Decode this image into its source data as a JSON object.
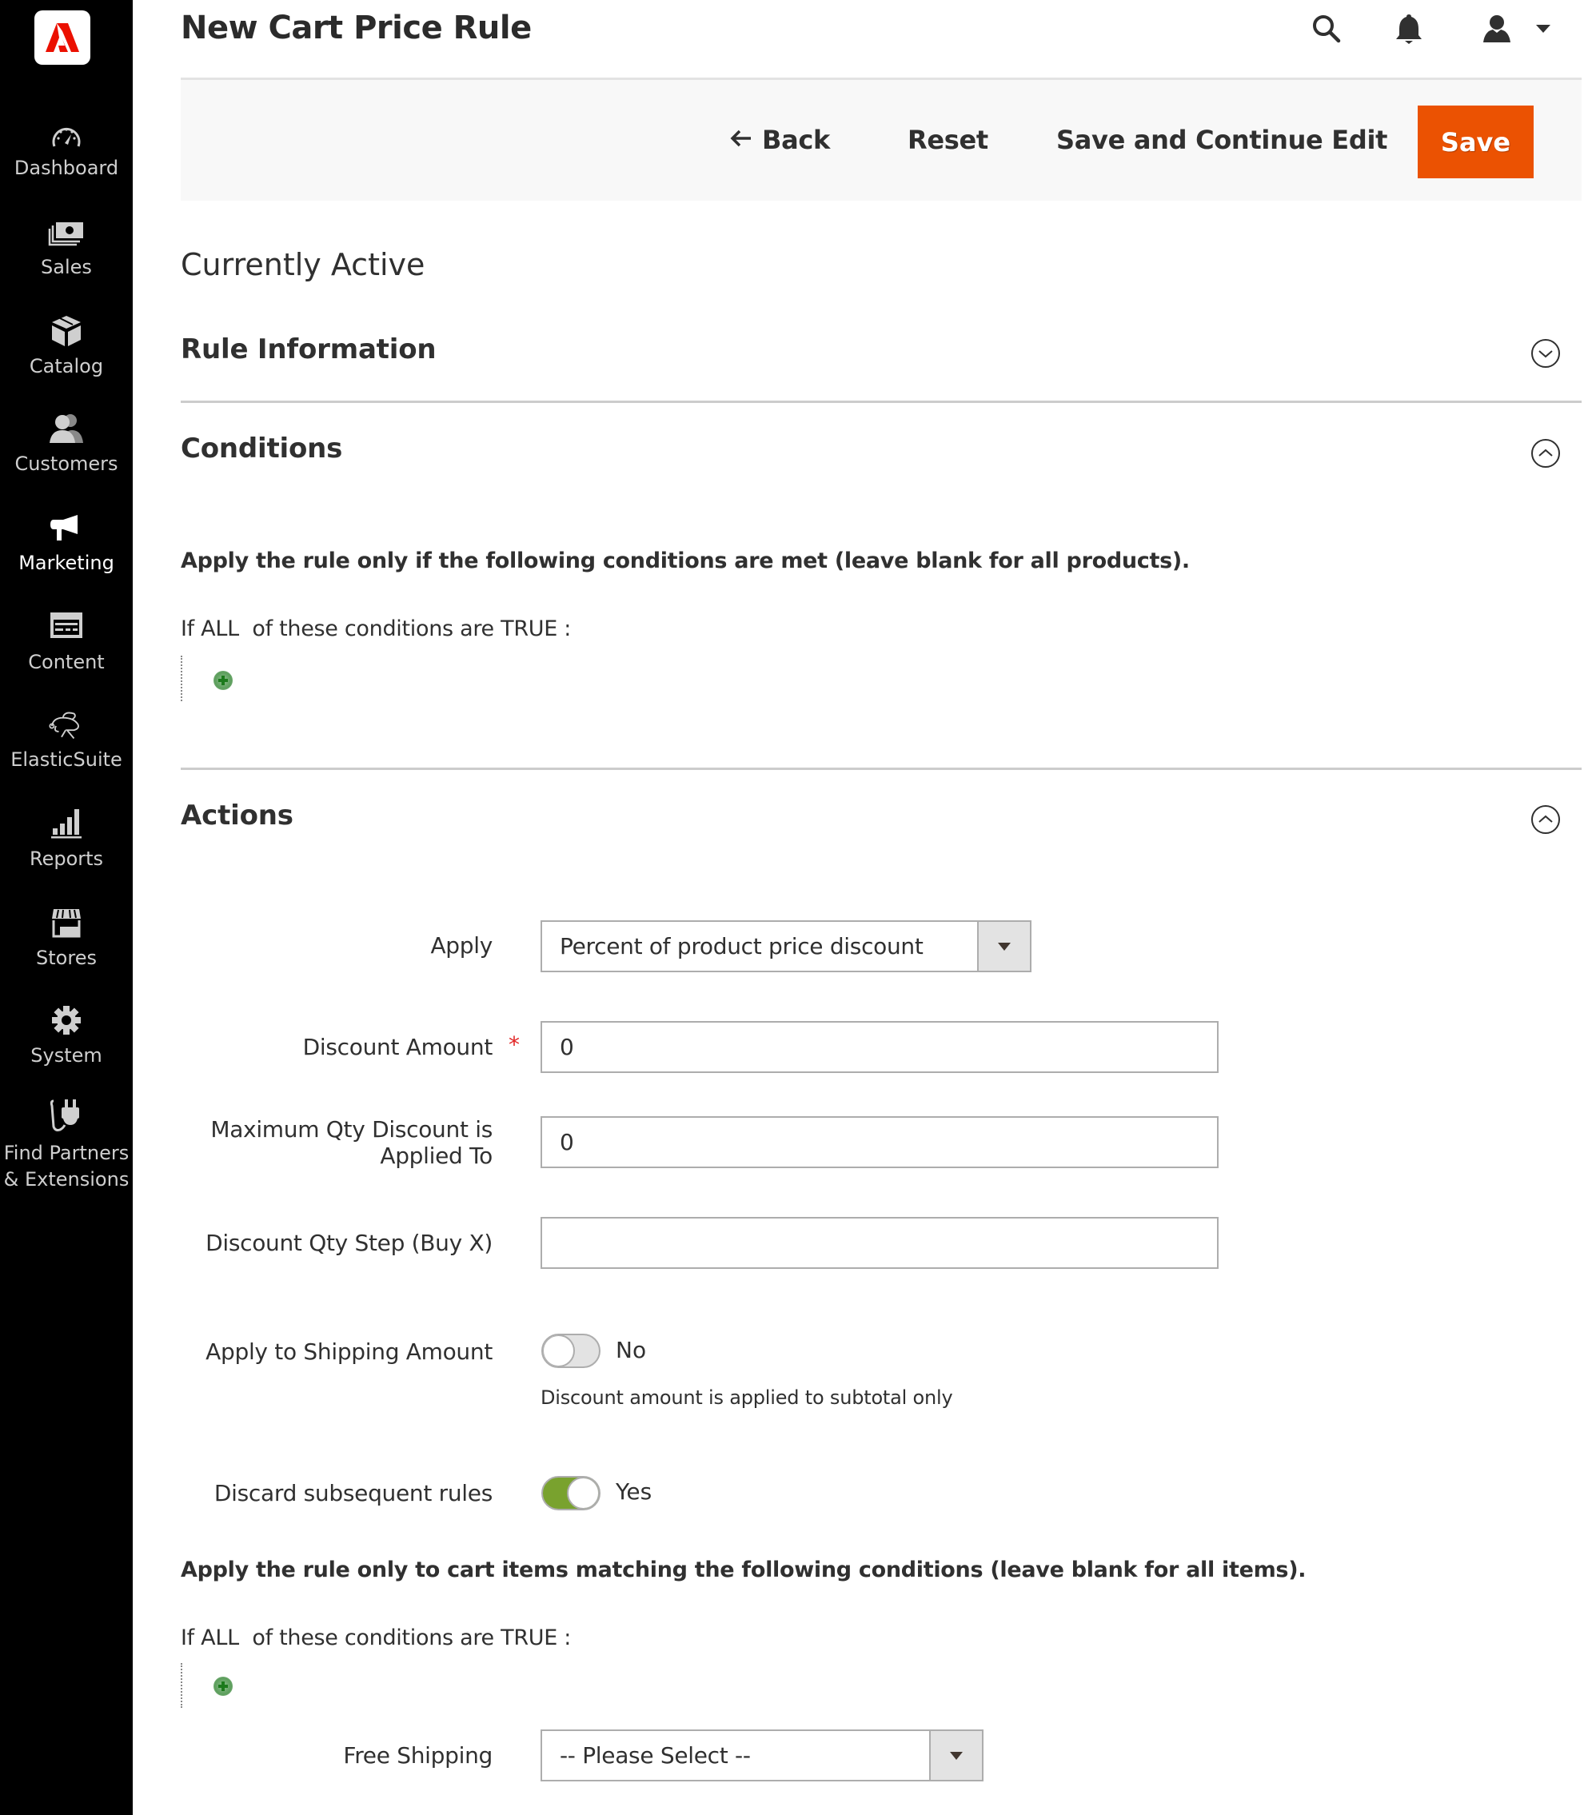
{
  "sidebar": {
    "logo": "adobe-commerce-logo",
    "items": [
      {
        "label": "Dashboard",
        "icon": "dashboard-icon",
        "active": false
      },
      {
        "label": "Sales",
        "icon": "sales-icon",
        "active": false
      },
      {
        "label": "Catalog",
        "icon": "catalog-icon",
        "active": false
      },
      {
        "label": "Customers",
        "icon": "customers-icon",
        "active": false
      },
      {
        "label": "Marketing",
        "icon": "marketing-icon",
        "active": true
      },
      {
        "label": "Content",
        "icon": "content-icon",
        "active": false
      },
      {
        "label": "ElasticSuite",
        "icon": "elasticsuite-icon",
        "active": false
      },
      {
        "label": "Reports",
        "icon": "reports-icon",
        "active": false
      },
      {
        "label": "Stores",
        "icon": "stores-icon",
        "active": false
      },
      {
        "label": "System",
        "icon": "system-icon",
        "active": false
      },
      {
        "label_line1": "Find Partners",
        "label_line2": "& Extensions",
        "icon": "extensions-icon",
        "active": false
      }
    ]
  },
  "header": {
    "title": "New Cart Price Rule",
    "icons": [
      "search-icon",
      "notifications-icon",
      "user-icon",
      "user-menu-chevron-icon"
    ]
  },
  "toolbar": {
    "back_label": "Back",
    "reset_label": "Reset",
    "save_continue_label": "Save and Continue Edit",
    "save_label": "Save",
    "save_color": "#eb5202"
  },
  "status": "Currently Active",
  "sections": {
    "rule_information": {
      "title": "Rule Information",
      "expanded": false
    },
    "conditions": {
      "title": "Conditions",
      "expanded": true,
      "note": "Apply the rule only if the following conditions are met (leave blank for all products).",
      "prefix": "If",
      "aggregator": "ALL",
      "middle": " of these conditions are",
      "value": "TRUE",
      "suffix": " :"
    },
    "actions": {
      "title": "Actions",
      "expanded": true,
      "fields": {
        "apply": {
          "label": "Apply",
          "value": "Percent of product price discount"
        },
        "discount_amount": {
          "label": "Discount Amount",
          "value": "0",
          "required": true,
          "required_mark": "*"
        },
        "max_qty": {
          "label_line1": "Maximum Qty Discount is",
          "label_line2": "Applied To",
          "value": "0"
        },
        "discount_step": {
          "label": "Discount Qty Step (Buy X)",
          "value": ""
        },
        "apply_to_shipping": {
          "label": "Apply to Shipping Amount",
          "checked": false,
          "state_label": "No",
          "note": "Discount amount is applied to subtotal only"
        },
        "discard_subsequent": {
          "label": "Discard subsequent rules",
          "checked": true,
          "state_label": "Yes",
          "on_color": "#79a22e"
        },
        "free_shipping": {
          "label": "Free Shipping",
          "value": "-- Please Select --"
        }
      },
      "item_conditions": {
        "note": "Apply the rule only to cart items matching the following conditions (leave blank for all items).",
        "prefix": "If",
        "aggregator": "ALL",
        "middle": " of these conditions are",
        "value": "TRUE",
        "suffix": " :"
      }
    }
  }
}
